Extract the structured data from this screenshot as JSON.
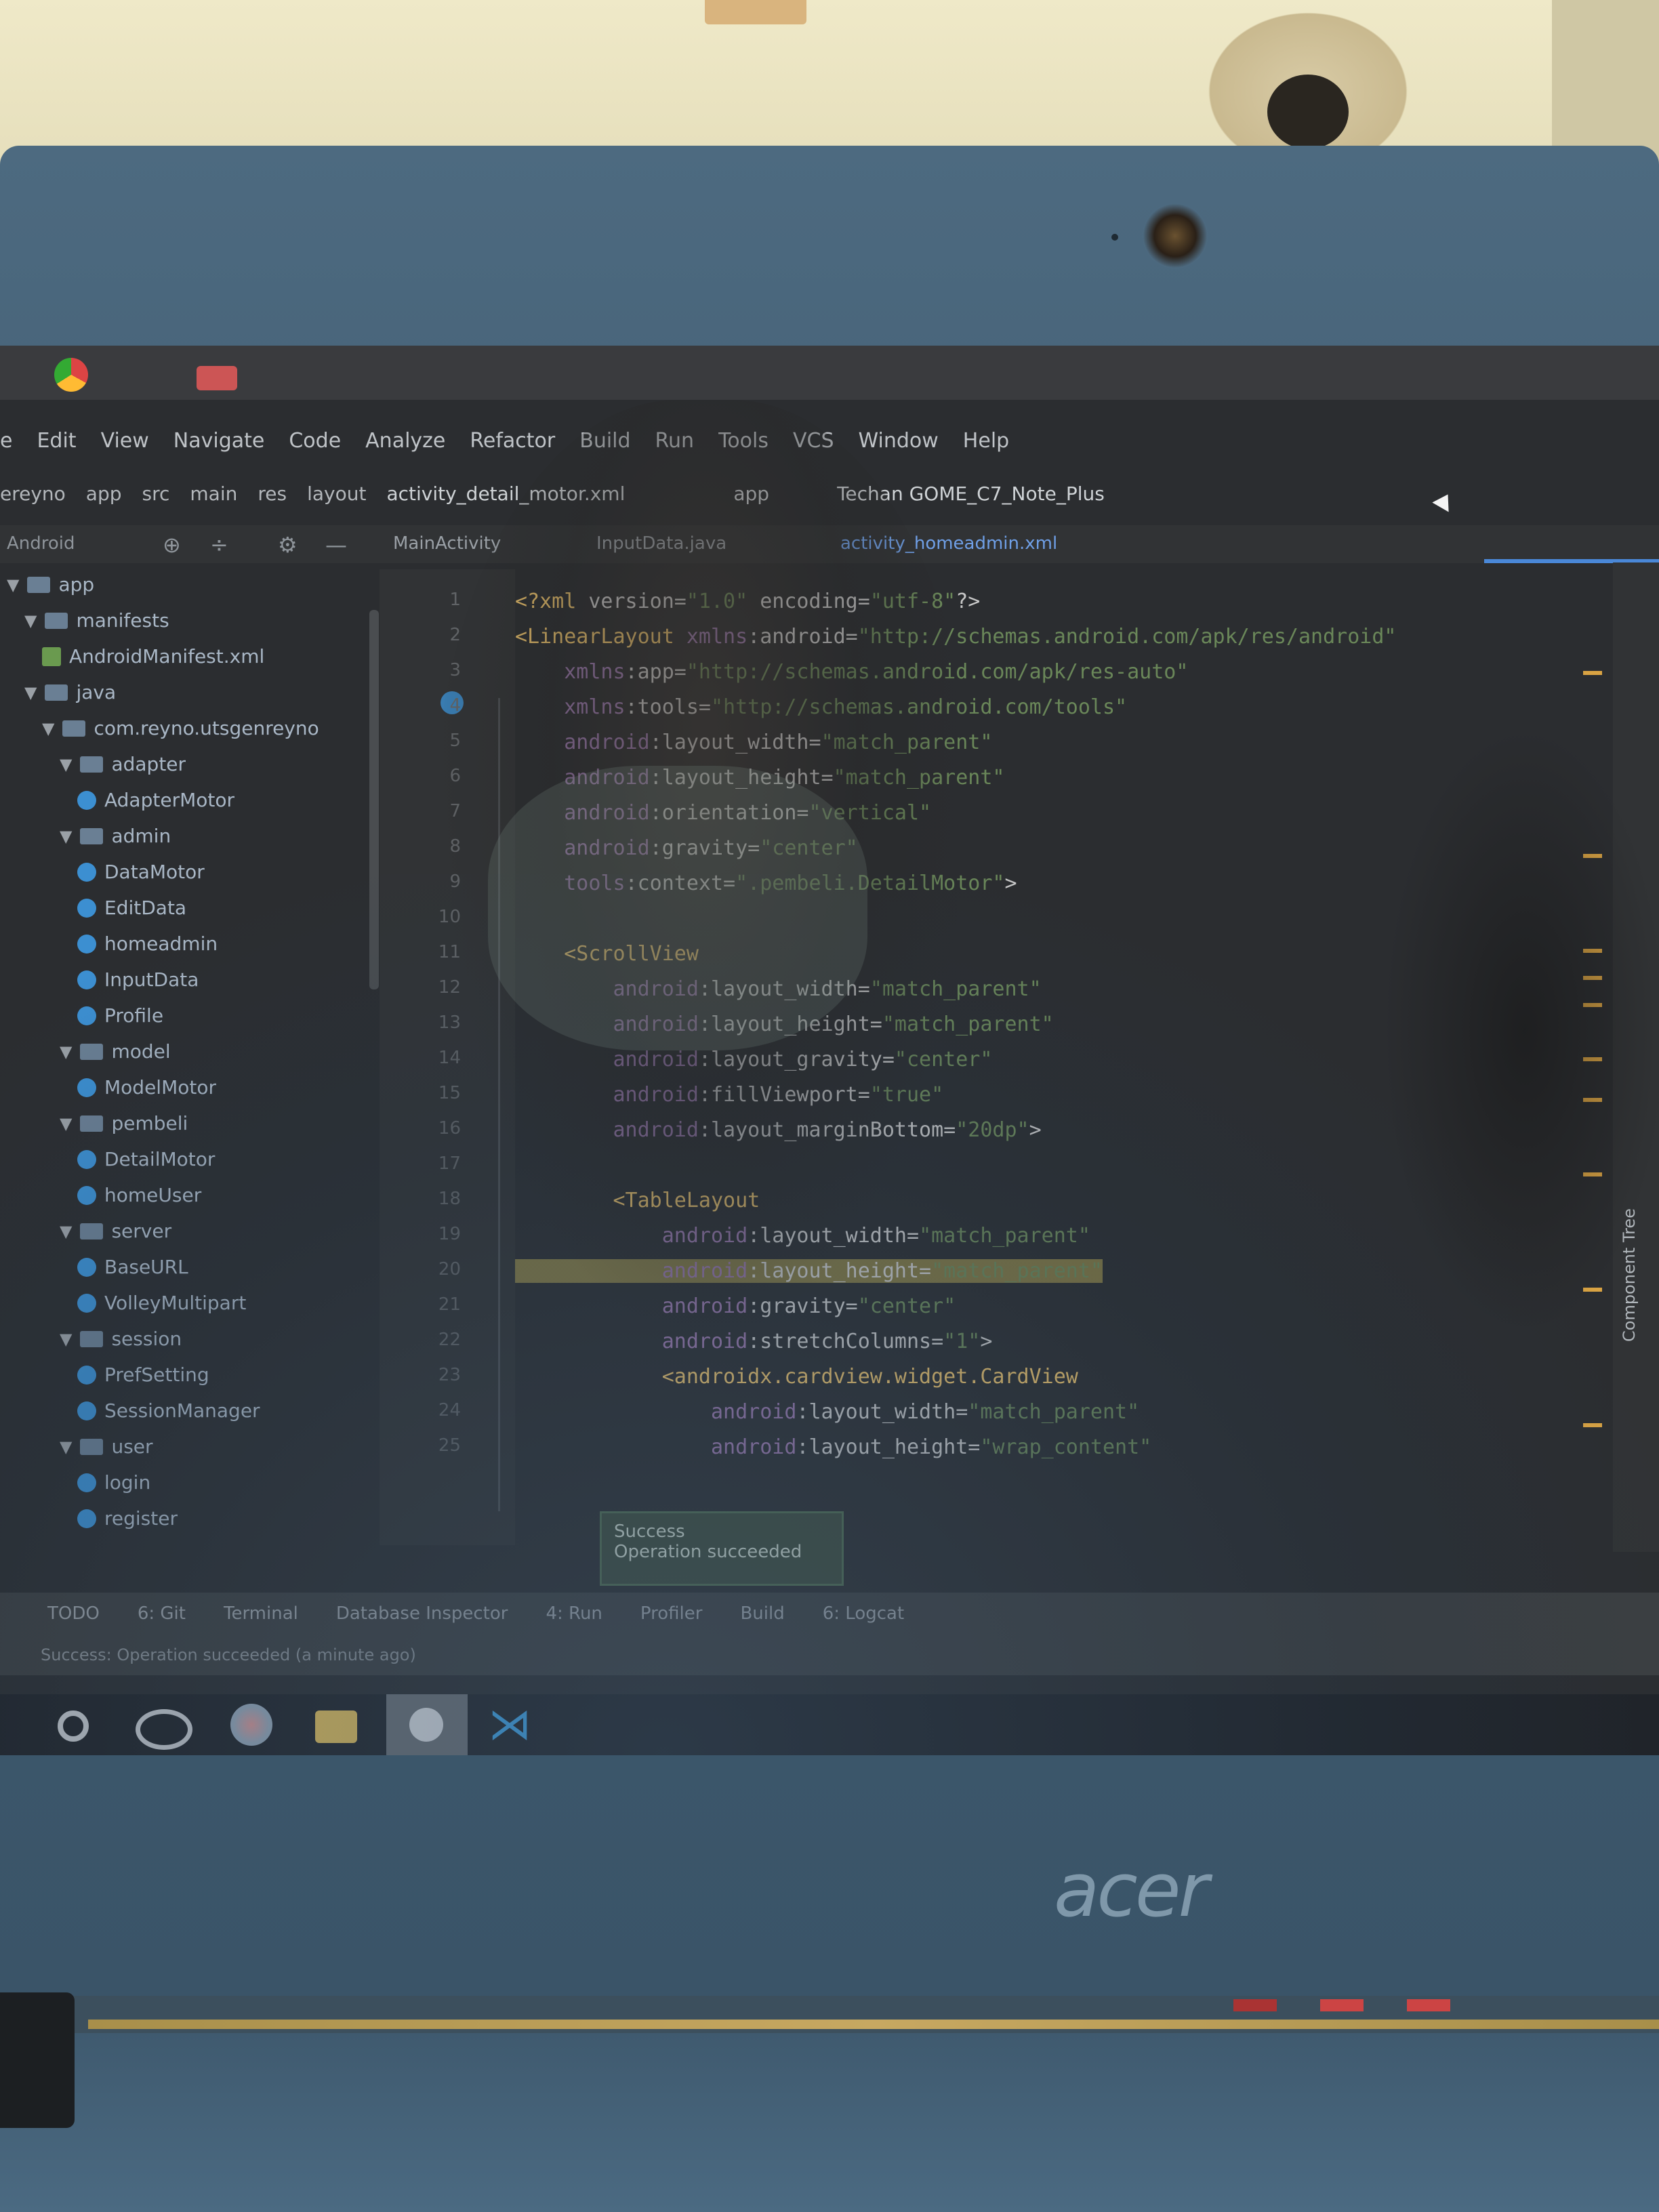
{
  "menu": [
    "e",
    "Edit",
    "View",
    "Navigate",
    "Code",
    "Analyze",
    "Refactor",
    "Build",
    "Run",
    "Tools",
    "VCS",
    "Window",
    "Help"
  ],
  "breadcrumb": [
    "ereyno",
    "app",
    "src",
    "main",
    "res",
    "layout"
  ],
  "current_file": "activity_detail_motor.xml",
  "run_config": "app",
  "device": "Techan GOME_C7_Note_Plus",
  "project_dropdown": "Android",
  "tabs": [
    "MainActivity",
    "InputData.java",
    "activity_homeadmin.xml"
  ],
  "tree": [
    {
      "label": "app",
      "type": "folder",
      "indent": 0
    },
    {
      "label": "manifests",
      "type": "folder",
      "indent": 1
    },
    {
      "label": "AndroidManifest.xml",
      "type": "manifest",
      "indent": 2
    },
    {
      "label": "java",
      "type": "folder",
      "indent": 1
    },
    {
      "label": "com.reyno.utsgenreyno",
      "type": "folder",
      "indent": 2
    },
    {
      "label": "adapter",
      "type": "folder",
      "indent": 3
    },
    {
      "label": "AdapterMotor",
      "type": "class",
      "indent": 4
    },
    {
      "label": "admin",
      "type": "folder",
      "indent": 3
    },
    {
      "label": "DataMotor",
      "type": "class",
      "indent": 4
    },
    {
      "label": "EditData",
      "type": "class",
      "indent": 4
    },
    {
      "label": "homeadmin",
      "type": "class",
      "indent": 4
    },
    {
      "label": "InputData",
      "type": "class",
      "indent": 4
    },
    {
      "label": "Profile",
      "type": "class",
      "indent": 4
    },
    {
      "label": "model",
      "type": "folder",
      "indent": 3
    },
    {
      "label": "ModelMotor",
      "type": "class",
      "indent": 4
    },
    {
      "label": "pembeli",
      "type": "folder",
      "indent": 3
    },
    {
      "label": "DetailMotor",
      "type": "class",
      "indent": 4
    },
    {
      "label": "homeUser",
      "type": "class",
      "indent": 4
    },
    {
      "label": "server",
      "type": "folder",
      "indent": 3
    },
    {
      "label": "BaseURL",
      "type": "class",
      "indent": 4
    },
    {
      "label": "VolleyMultipart",
      "type": "class",
      "indent": 4
    },
    {
      "label": "session",
      "type": "folder",
      "indent": 3
    },
    {
      "label": "PrefSetting",
      "type": "class",
      "indent": 4
    },
    {
      "label": "SessionManager",
      "type": "class",
      "indent": 4
    },
    {
      "label": "user",
      "type": "folder",
      "indent": 3
    },
    {
      "label": "login",
      "type": "class",
      "indent": 4
    },
    {
      "label": "register",
      "type": "class",
      "indent": 4
    }
  ],
  "code_lines": [
    {
      "n": "1",
      "text": "<?xml version=\"1.0\" encoding=\"utf-8\"?>"
    },
    {
      "n": "2",
      "text": "<LinearLayout xmlns:android=\"http://schemas.android.com/apk/res/android\""
    },
    {
      "n": "3",
      "text": "    xmlns:app=\"http://schemas.android.com/apk/res-auto\""
    },
    {
      "n": "4",
      "text": "    xmlns:tools=\"http://schemas.android.com/tools\""
    },
    {
      "n": "5",
      "text": "    android:layout_width=\"match_parent\""
    },
    {
      "n": "6",
      "text": "    android:layout_height=\"match_parent\""
    },
    {
      "n": "7",
      "text": "    android:orientation=\"vertical\""
    },
    {
      "n": "8",
      "text": "    android:gravity=\"center\""
    },
    {
      "n": "9",
      "text": "    tools:context=\".pembeli.DetailMotor\">"
    },
    {
      "n": "10",
      "text": ""
    },
    {
      "n": "11",
      "text": "    <ScrollView"
    },
    {
      "n": "12",
      "text": "        android:layout_width=\"match_parent\""
    },
    {
      "n": "13",
      "text": "        android:layout_height=\"match_parent\""
    },
    {
      "n": "14",
      "text": "        android:layout_gravity=\"center\""
    },
    {
      "n": "15",
      "text": "        android:fillViewport=\"true\""
    },
    {
      "n": "16",
      "text": "        android:layout_marginBottom=\"20dp\">"
    },
    {
      "n": "17",
      "text": ""
    },
    {
      "n": "18",
      "text": "        <TableLayout"
    },
    {
      "n": "19",
      "text": "            android:layout_width=\"match_parent\""
    },
    {
      "n": "20",
      "text": "            android:layout_height=\"match_parent\""
    },
    {
      "n": "21",
      "text": "            android:gravity=\"center\""
    },
    {
      "n": "22",
      "text": "            android:stretchColumns=\"1\">"
    },
    {
      "n": "23",
      "text": "            <androidx.cardview.widget.CardView"
    },
    {
      "n": "24",
      "text": "                android:layout_width=\"match_parent\""
    },
    {
      "n": "25",
      "text": "                android:layout_height=\"wrap_content\""
    }
  ],
  "toast": {
    "title": "Success",
    "message": "Operation succeeded"
  },
  "bottom_tools": [
    "TODO",
    "6: Git",
    "Terminal",
    "Database Inspector",
    "4: Run",
    "Profiler",
    "Build",
    "6: Logcat"
  ],
  "status_message": "Success: Operation succeeded (a minute ago)",
  "side_panel_label": "Component Tree",
  "brand": "acer"
}
